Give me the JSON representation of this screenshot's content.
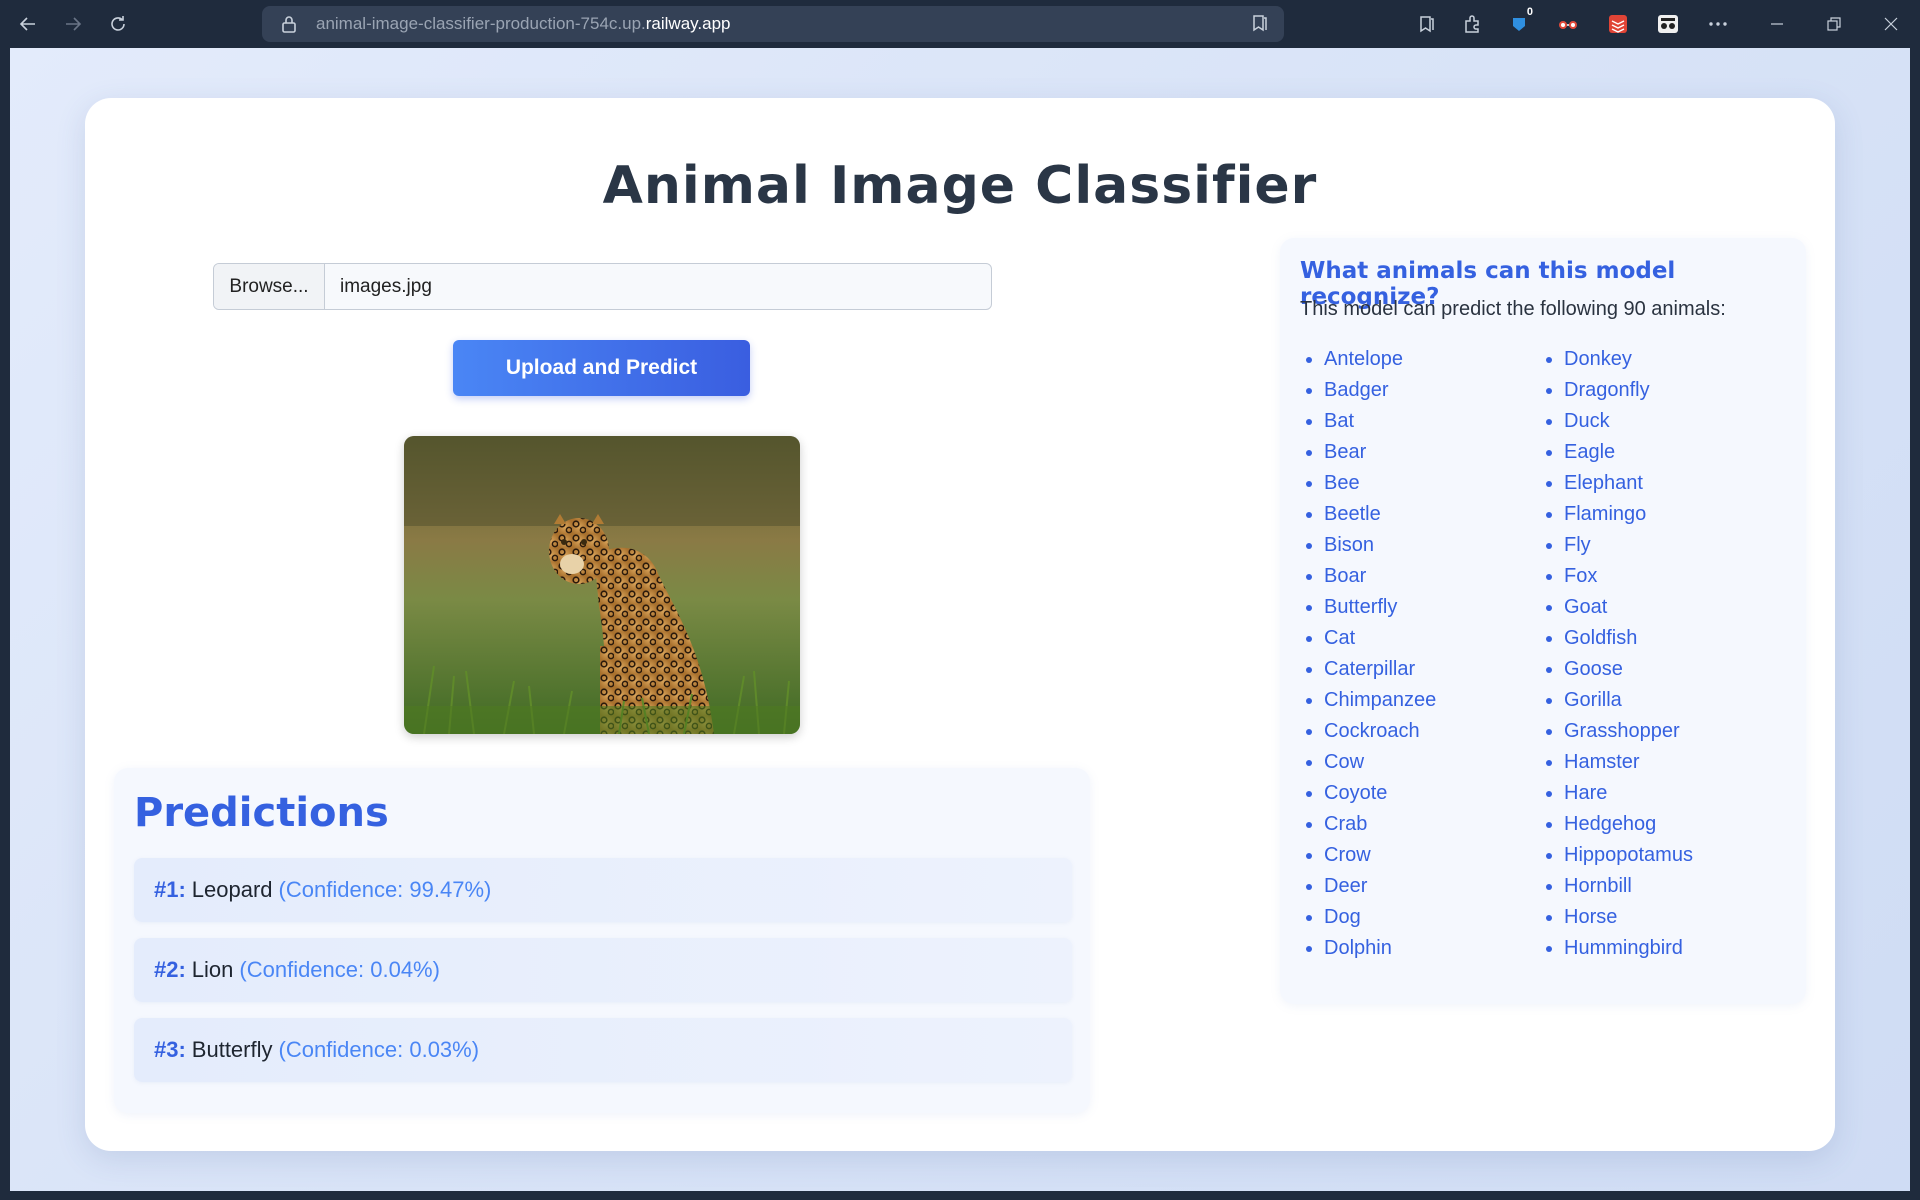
{
  "browser": {
    "url_prefix": "animal-image-classifier-production-754c.up.",
    "url_host": "railway.app",
    "extension_badge": "0"
  },
  "page": {
    "title": "Animal Image Classifier",
    "file_input": {
      "browse_label": "Browse...",
      "file_name": "images.jpg"
    },
    "upload_button": "Upload and Predict",
    "predictions": {
      "heading": "Predictions",
      "items": [
        {
          "rank": "#1:",
          "label": "Leopard",
          "confidence": "(Confidence: 99.47%)"
        },
        {
          "rank": "#2:",
          "label": "Lion",
          "confidence": "(Confidence: 0.04%)"
        },
        {
          "rank": "#3:",
          "label": "Butterfly",
          "confidence": "(Confidence: 0.03%)"
        }
      ]
    },
    "sidebar": {
      "heading": "What animals can this model recognize?",
      "description": "This model can predict the following 90 animals:",
      "column1": [
        "Antelope",
        "Badger",
        "Bat",
        "Bear",
        "Bee",
        "Beetle",
        "Bison",
        "Boar",
        "Butterfly",
        "Cat",
        "Caterpillar",
        "Chimpanzee",
        "Cockroach",
        "Cow",
        "Coyote",
        "Crab",
        "Crow",
        "Deer",
        "Dog",
        "Dolphin"
      ],
      "column2": [
        "Donkey",
        "Dragonfly",
        "Duck",
        "Eagle",
        "Elephant",
        "Flamingo",
        "Fly",
        "Fox",
        "Goat",
        "Goldfish",
        "Goose",
        "Gorilla",
        "Grasshopper",
        "Hamster",
        "Hare",
        "Hedgehog",
        "Hippopotamus",
        "Hornbill",
        "Horse",
        "Hummingbird"
      ]
    }
  },
  "colors": {
    "accent": "#3561e0",
    "accent_light": "#4a86f5",
    "chrome_bg": "#1f2b3d"
  }
}
